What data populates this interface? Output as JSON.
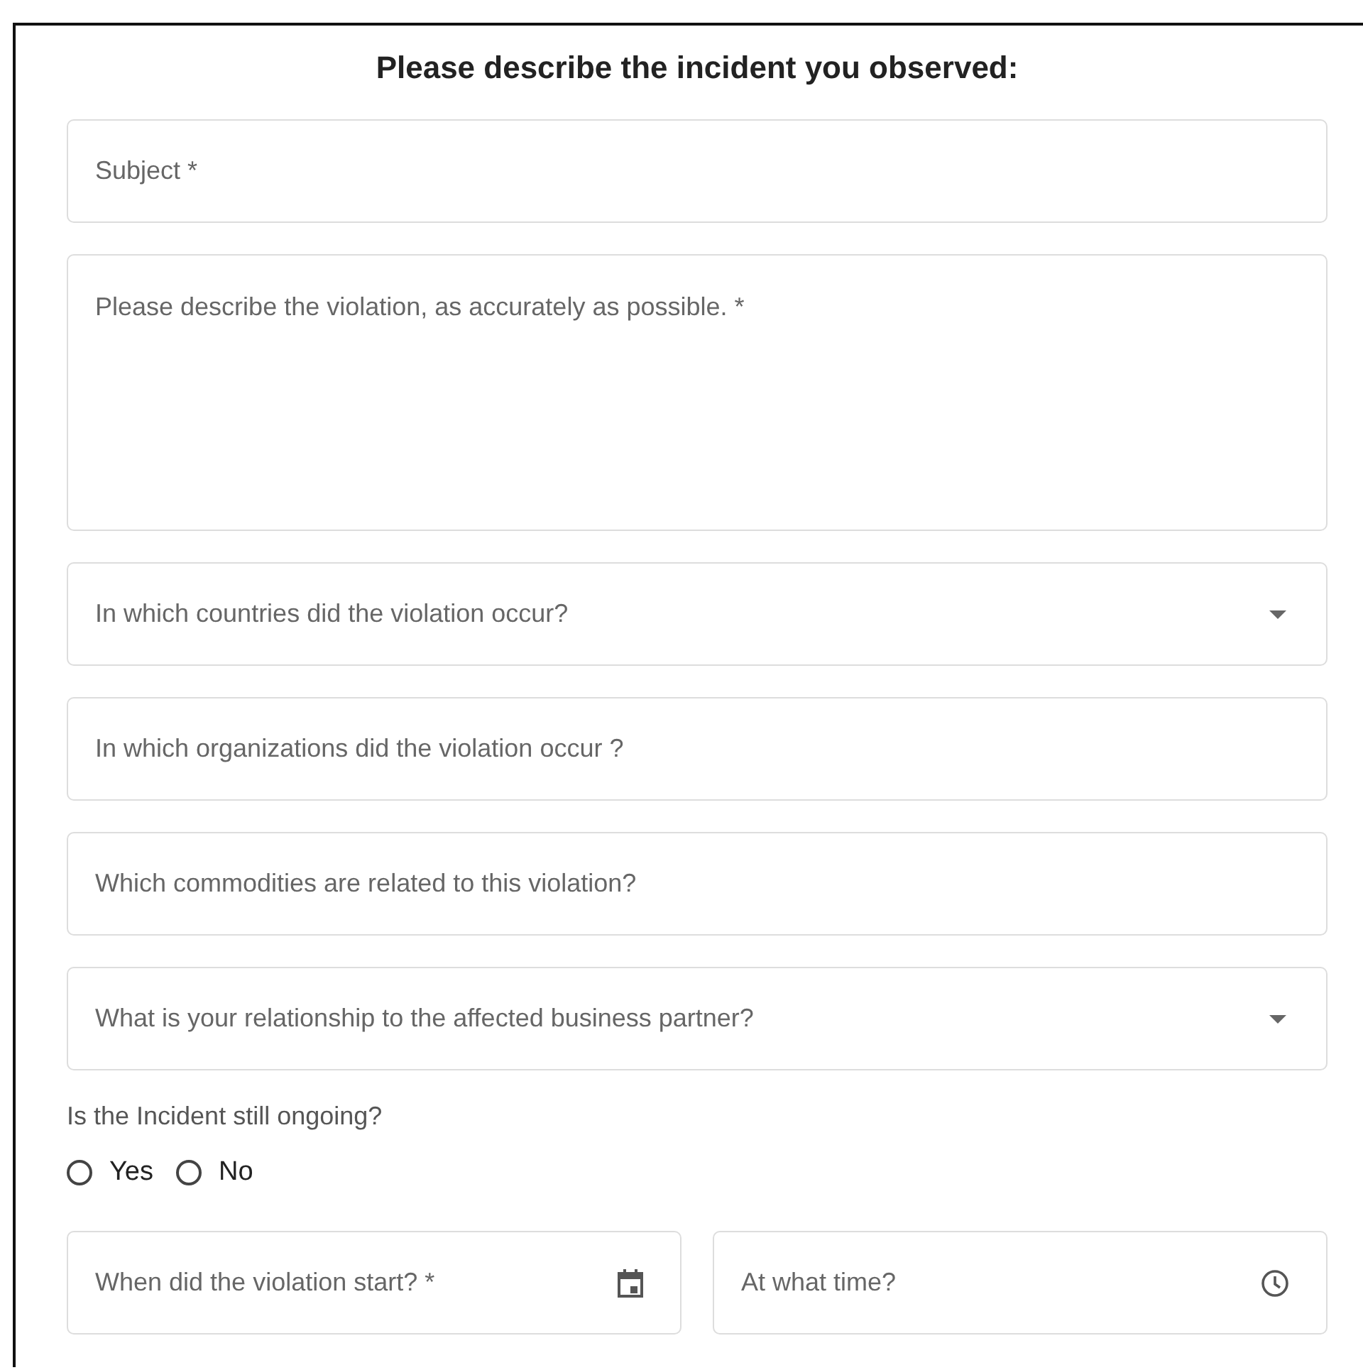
{
  "title": "Please describe the incident you observed:",
  "fields": [
    {
      "kind": "text",
      "placeholder": "Subject *"
    },
    {
      "kind": "textarea",
      "placeholder": "Please describe the violation, as accurately as possible. *"
    },
    {
      "kind": "select",
      "placeholder": "In which countries did the violation occur?"
    },
    {
      "kind": "text",
      "placeholder": "In which organizations did the violation occur ?"
    },
    {
      "kind": "text",
      "placeholder": "Which commodities are related to this violation?"
    },
    {
      "kind": "select",
      "placeholder": "What is your relationship to the affected business partner?"
    }
  ],
  "question": "Is the Incident still ongoing?",
  "options": [
    {
      "label": "Yes",
      "selected": false
    },
    {
      "label": "No",
      "selected": false
    }
  ],
  "pickers": [
    {
      "kind": "date",
      "placeholder": "When did the violation start? *"
    },
    {
      "kind": "time",
      "placeholder": "At what time?"
    }
  ]
}
